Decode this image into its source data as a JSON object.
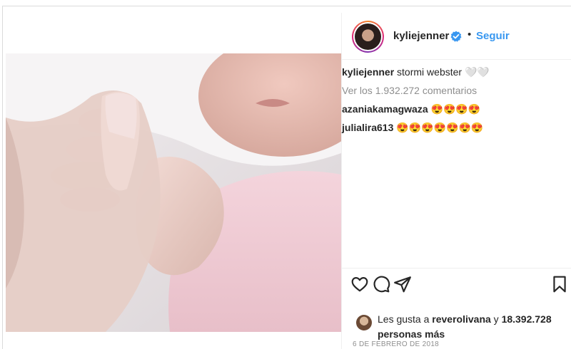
{
  "post": {
    "username": "kyliejenner",
    "follow_label": "Seguir",
    "separator": "•",
    "caption_user": "kyliejenner",
    "caption_text": "stormi webster 🤍🤍",
    "view_comments": "Ver los 1.932.272 comentarios",
    "comments": [
      {
        "user": "azaniakamagwaza",
        "text": "😍😍😍😍"
      },
      {
        "user": "julialira613",
        "text": "😍😍😍😍😍😍😍"
      }
    ],
    "likes_prefix": "Les gusta a",
    "likes_user": "reverolivana",
    "likes_conj": "y",
    "likes_count": "18.392.728 personas más",
    "date": "6 DE FEBRERO DE 2018"
  },
  "icons": {
    "like": "heart-icon",
    "comment": "comment-icon",
    "share": "share-icon",
    "save": "bookmark-icon",
    "verified": "verified-badge-icon"
  },
  "colors": {
    "link": "#3897f0",
    "verified": "#3897f0",
    "muted": "#8e8e8e"
  }
}
